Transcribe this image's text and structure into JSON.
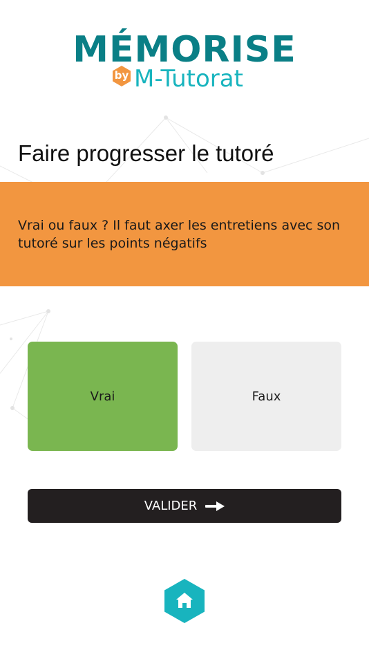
{
  "logo": {
    "main": "MÉMORISE",
    "by": "by",
    "sub": "M-Tutorat"
  },
  "page": {
    "title": "Faire progresser le tutoré"
  },
  "question": {
    "text": "Vrai ou faux ? Il faut axer les entretiens avec son tutoré sur les points négatifs"
  },
  "answers": {
    "true_label": "Vrai",
    "false_label": "Faux",
    "selected": "Vrai"
  },
  "actions": {
    "validate_label": "VALIDER",
    "validate_icon": "arrow-right-icon",
    "home_icon": "home-icon"
  },
  "colors": {
    "brand_dark": "#0a7f86",
    "brand_light": "#18b4be",
    "accent_orange": "#f29640",
    "selected_green": "#7ab650",
    "unselected_gray": "#eeeeee",
    "button_dark": "#231f20"
  }
}
